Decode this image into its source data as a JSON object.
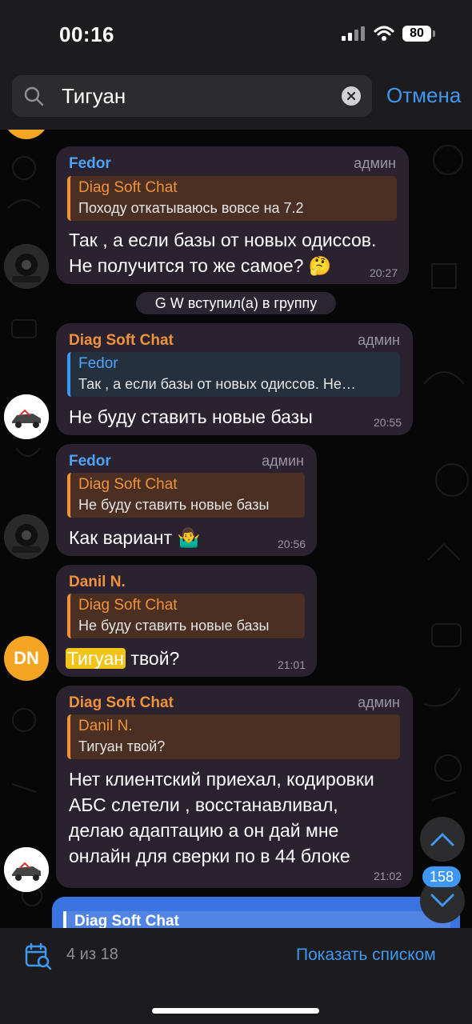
{
  "status": {
    "time": "00:16",
    "battery": "80"
  },
  "search": {
    "value": "Тигуан",
    "cancel_label": "Отмена"
  },
  "service_message": "G W вступил(а) в группу",
  "messages": [
    {
      "sender": "Fedor",
      "role": "админ",
      "reply_name": "Diag Soft Chat",
      "reply_text": "Походу откатываюсь вовсе на 7.2",
      "text_line1": "Так , а если базы от новых одиссов.",
      "text_line2": "Не получится то же самое? 🤔",
      "time": "20:27"
    },
    {
      "sender": "Diag Soft Chat",
      "role": "админ",
      "reply_name": "Fedor",
      "reply_text": "Так , а если базы от новых одиссов. Не…",
      "text": "Не буду ставить новые базы",
      "time": "20:55"
    },
    {
      "sender": "Fedor",
      "role": "админ",
      "reply_name": "Diag Soft Chat",
      "reply_text": "Не буду ставить новые базы",
      "text": "Как вариант 🤷‍♂️",
      "time": "20:56"
    },
    {
      "sender": "Danil N.",
      "avatar_initials": "DN",
      "reply_name": "Diag Soft Chat",
      "reply_text": "Не буду ставить новые базы",
      "text_highlight": "Тигуан",
      "text_rest": " твой?",
      "time": "21:01"
    },
    {
      "sender": "Diag Soft Chat",
      "role": "админ",
      "reply_name": "Danil N.",
      "reply_text": "Тигуан твой?",
      "text_line1": "Нет клиентский приехал, кодировки",
      "text_line2": "АБС слетели , восстанавливал,",
      "text_line3": "делаю адаптацию а он дай мне",
      "text_line4": "онлайн для сверки по в 44 блоке",
      "time": "21:02"
    }
  ],
  "next_message_reply_name": "Diag Soft Chat",
  "scroll": {
    "unread_count": "158"
  },
  "bottom": {
    "counter": "4 из 18",
    "show_list_label": "Показать списком"
  },
  "colors": {
    "accent": "#3e97f0",
    "orange_name": "#f0923a",
    "highlight": "#f0c419",
    "bubble": "#2b2230"
  }
}
